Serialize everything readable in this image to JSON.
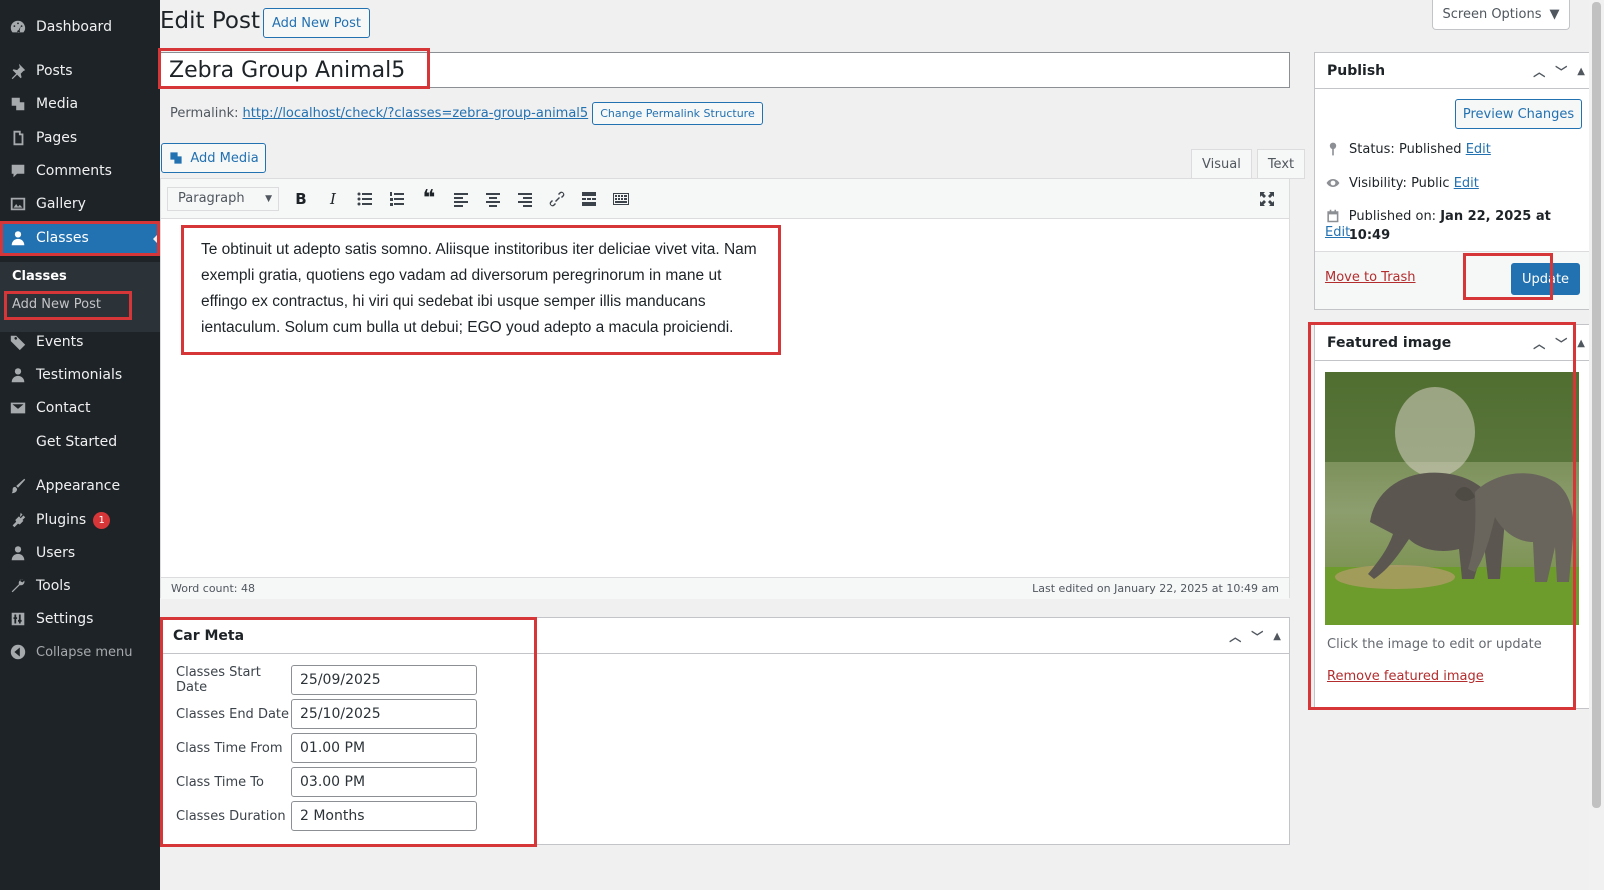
{
  "sidebar": {
    "items": [
      {
        "label": "Dashboard",
        "icon": "dashboard-icon"
      },
      {
        "label": "Posts",
        "icon": "pin-icon"
      },
      {
        "label": "Media",
        "icon": "media-icon"
      },
      {
        "label": "Pages",
        "icon": "pages-icon"
      },
      {
        "label": "Comments",
        "icon": "comments-icon"
      },
      {
        "label": "Gallery",
        "icon": "gallery-icon"
      },
      {
        "label": "Classes",
        "icon": "user-icon"
      },
      {
        "label": "Events",
        "icon": "tag-icon"
      },
      {
        "label": "Testimonials",
        "icon": "user-icon"
      },
      {
        "label": "Contact",
        "icon": "email-icon"
      },
      {
        "label": "Get Started",
        "icon": ""
      },
      {
        "label": "Appearance",
        "icon": "brush-icon"
      },
      {
        "label": "Plugins",
        "icon": "plugin-icon",
        "badge": "1"
      },
      {
        "label": "Users",
        "icon": "users-icon"
      },
      {
        "label": "Tools",
        "icon": "wrench-icon"
      },
      {
        "label": "Settings",
        "icon": "settings-icon"
      }
    ],
    "submenu": {
      "current": "Classes",
      "add_new": "Add New Post"
    },
    "collapse_label": "Collapse menu"
  },
  "header": {
    "title": "Edit Post",
    "add_new_label": "Add New Post",
    "screen_options": "Screen Options"
  },
  "post": {
    "title": "Zebra Group Animal5",
    "permalink_label": "Permalink:",
    "permalink_url": "http://localhost/check/?classes=zebra-group-animal5",
    "change_permalink": "Change Permalink Structure"
  },
  "editor": {
    "add_media": "Add Media",
    "tab_visual": "Visual",
    "tab_text": "Text",
    "format": "Paragraph",
    "content": "Te obtinuit ut adepto satis somno. Aliisque institoribus iter deliciae vivet vita. Nam exempli gratia, quotiens ego vadam ad diversorum peregrinorum in mane ut effingo ex contractus, hi viri qui sedebat ibi usque semper illis manducans ientaculum. Solum cum bulla ut debui; EGO youd adepto a macula proiciendi.",
    "word_count": "Word count: 48",
    "last_edited": "Last edited on January 22, 2025 at 10:49 am"
  },
  "car_meta": {
    "title": "Car Meta",
    "fields": [
      {
        "label": "Classes Start Date",
        "value": "25/09/2025"
      },
      {
        "label": "Classes End Date",
        "value": "25/10/2025"
      },
      {
        "label": "Class Time From",
        "value": "01.00 PM"
      },
      {
        "label": "Class Time To",
        "value": "03.00 PM"
      },
      {
        "label": "Classes Duration",
        "value": "2 Months"
      }
    ]
  },
  "publish": {
    "title": "Publish",
    "preview": "Preview Changes",
    "status_label": "Status:",
    "status_value": "Published",
    "visibility_label": "Visibility:",
    "visibility_value": "Public",
    "published_label": "Published on:",
    "published_value": "Jan 22, 2025 at 10:49",
    "edit": "Edit",
    "trash": "Move to Trash",
    "update": "Update"
  },
  "featured": {
    "title": "Featured image",
    "hint": "Click the image to edit or update",
    "remove": "Remove featured image"
  }
}
